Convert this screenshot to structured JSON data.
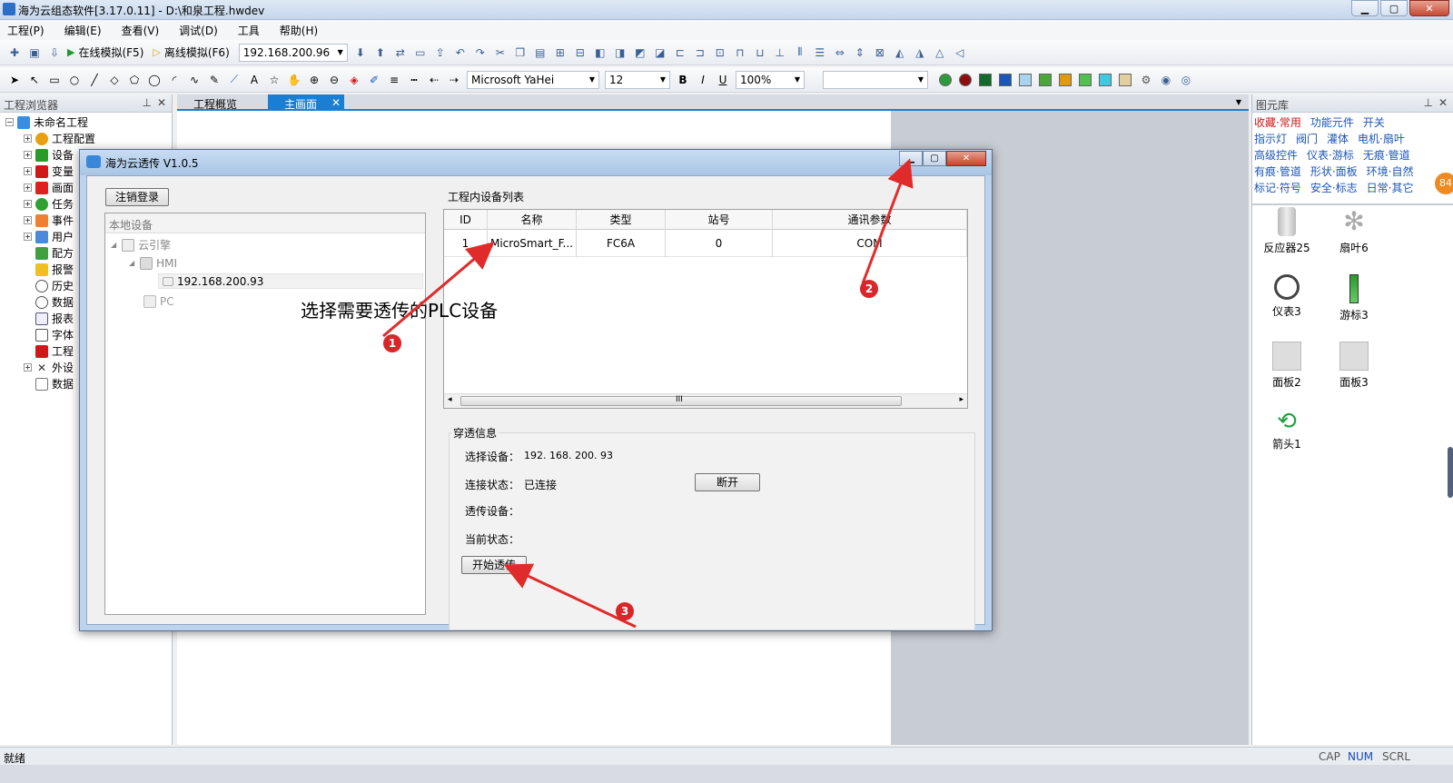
{
  "app": {
    "title": "海为云组态软件[3.17.0.11] - D:\\和泉工程.hwdev",
    "window_buttons": [
      "▁",
      "▢",
      "✕"
    ]
  },
  "menu": [
    "工程(P)",
    "编辑(E)",
    "查看(V)",
    "调试(D)",
    "工具",
    "帮助(H)"
  ],
  "toolbar1": {
    "online_sim": "在线模拟(F5)",
    "offline_sim": "离线模拟(F6)",
    "ip_value": "192.168.200.96"
  },
  "toolbar2": {
    "font_family": "Microsoft YaHei",
    "font_size": "12",
    "bold": "B",
    "italic": "I",
    "underline": "U",
    "zoom": "100%",
    "text_tool": "A"
  },
  "project_browser": {
    "title": "工程浏览器",
    "root": "未命名工程",
    "items": [
      "工程配置",
      "设备",
      "变量",
      "画面",
      "任务",
      "事件",
      "用户",
      "配方",
      "报警",
      "历史",
      "数据",
      "报表",
      "字体",
      "工程",
      "外设",
      "数据"
    ]
  },
  "tabs": [
    "工程概览",
    "主画面"
  ],
  "library": {
    "title": "图元库",
    "links": [
      [
        "收藏·常用",
        "功能元件",
        "开关"
      ],
      [
        "指示灯",
        "阀门",
        "灌体",
        "电机·扇叶"
      ],
      [
        "高级控件",
        "仪表·游标",
        "无痕·管道"
      ],
      [
        "有痕·管道",
        "形状·面板",
        "环境·自然"
      ],
      [
        "标记·符号",
        "安全·标志",
        "日常·其它"
      ]
    ],
    "items": [
      "反应器25",
      "扇叶6",
      "仪表3",
      "游标3",
      "面板2",
      "面板3",
      "箭头1"
    ],
    "badge": "84"
  },
  "status": {
    "left": "就绪",
    "cap": "CAP",
    "num": "NUM",
    "scrl": "SCRL"
  },
  "dialog": {
    "title": "海为云透传 V1.0.5",
    "logout_button": "注销登录",
    "local_devices_header": "本地设备",
    "tree": {
      "cloud_engine": "云引擎",
      "hmi": "HMI",
      "hmi_ip": "192.168.200.93",
      "pc": "PC"
    },
    "device_list_title": "工程内设备列表",
    "columns": [
      "ID",
      "名称",
      "类型",
      "站号",
      "通讯参数"
    ],
    "rows": [
      [
        "1",
        "MicroSmart_F...",
        "FC6A",
        "0",
        "COM"
      ]
    ],
    "scroll_grip": "III",
    "info": {
      "group_title": "穿透信息",
      "selected_label": "选择设备：",
      "selected_value": "192. 168. 200. 93",
      "conn_label": "连接状态：",
      "conn_value": "已连接",
      "disconnect_button": "断开",
      "pass_device_label": "透传设备：",
      "current_state_label": "当前状态：",
      "start_button": "开始透传"
    }
  },
  "annotations": {
    "instruction": "选择需要透传的PLC设备",
    "markers": [
      "1",
      "2",
      "3"
    ],
    "arrow_color": "#e02b2b"
  }
}
